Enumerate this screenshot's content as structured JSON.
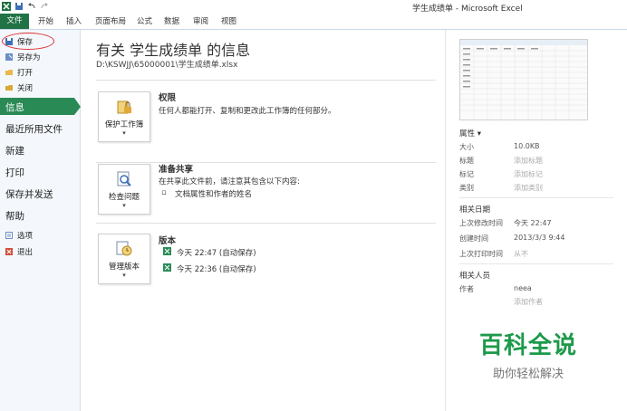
{
  "window": {
    "title": "学生成绩单 - Microsoft Excel"
  },
  "tabs": [
    "文件",
    "开始",
    "插入",
    "页面布局",
    "公式",
    "数据",
    "审阅",
    "视图"
  ],
  "sidebar": {
    "save": "保存",
    "save_as": "另存为",
    "open": "打开",
    "close": "关闭",
    "info": "信息",
    "recent": "最近所用文件",
    "new": "新建",
    "print": "打印",
    "save_send": "保存并发送",
    "help": "帮助",
    "options": "选项",
    "exit": "退出"
  },
  "info": {
    "title": "有关 学生成绩单 的信息",
    "path": "D:\\KSWJJ\\65000001\\学生成绩单.xlsx"
  },
  "sections": {
    "permissions": {
      "button": "保护工作簿",
      "heading": "权限",
      "desc": "任何人都能打开、复制和更改此工作簿的任何部分。"
    },
    "prepare": {
      "button": "检查问题",
      "heading": "准备共享",
      "desc": "在共享此文件前，请注意其包含以下内容:",
      "bullet": "文档属性和作者的姓名"
    },
    "versions": {
      "button": "管理版本",
      "heading": "版本",
      "v1": "今天 22:47 (自动保存)",
      "v2": "今天 22:36 (自动保存)"
    },
    "dropdown": "▾"
  },
  "properties": {
    "heading": "属性 ▾",
    "size_label": "大小",
    "size_value": "10.0KB",
    "title_label": "标题",
    "title_value": "添加标题",
    "tags_label": "标记",
    "tags_value": "添加标记",
    "category_label": "类别",
    "category_value": "添加类别",
    "dates_heading": "相关日期",
    "modified_label": "上次修改时间",
    "modified_value": "今天 22:47",
    "created_label": "创建时间",
    "created_value": "2013/3/3 9:44",
    "printed_label": "上次打印时间",
    "printed_value": "从不",
    "people_heading": "相关人员",
    "author_label": "作者",
    "author_value": "neea",
    "add_author": "添加作者"
  },
  "watermark": {
    "big": "百科全说",
    "small": "助你轻松解决"
  },
  "colors": {
    "file_tab": "#217346",
    "active_nav": "#2a8a55",
    "watermark": "#1c9a4a"
  }
}
